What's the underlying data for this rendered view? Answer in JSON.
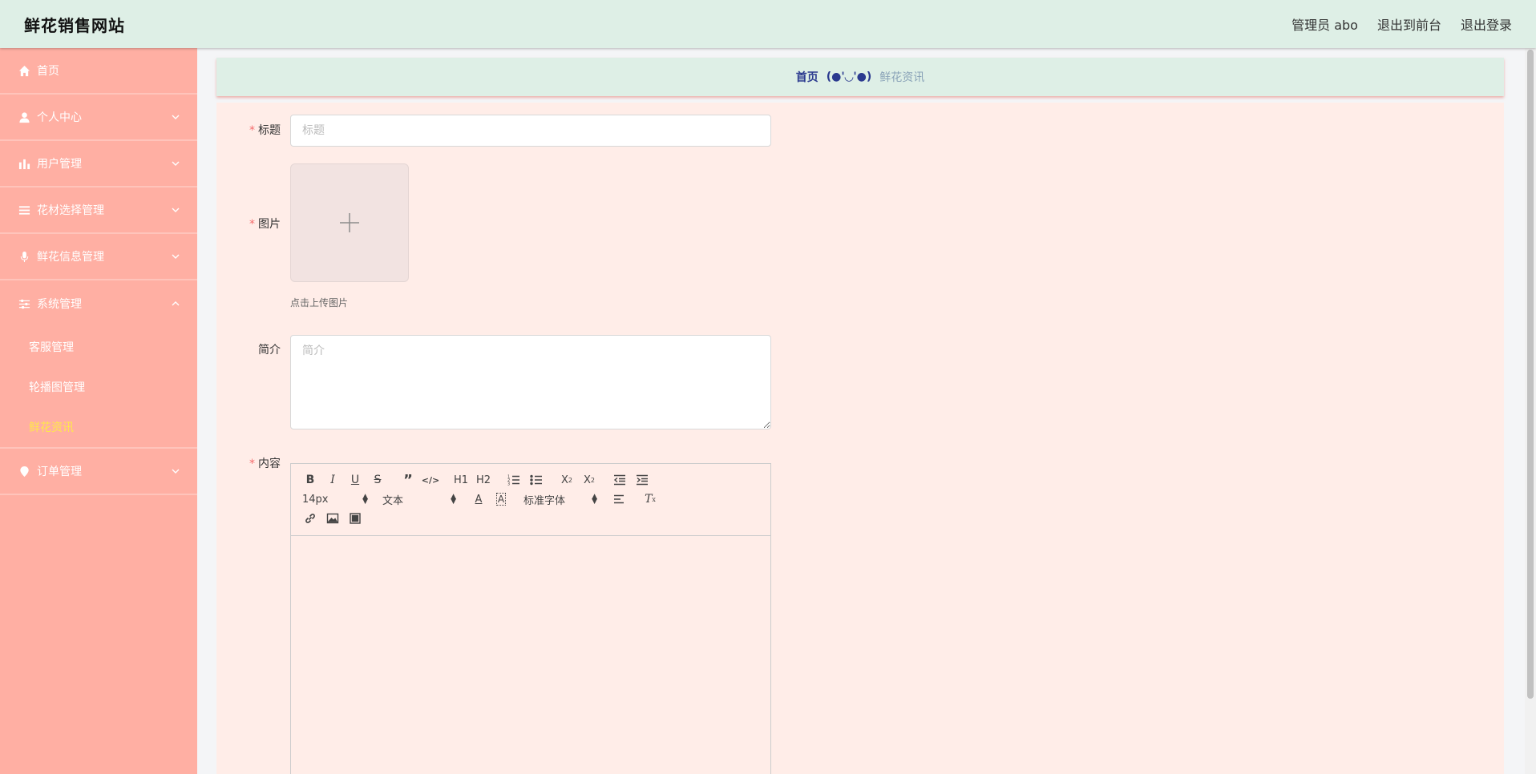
{
  "header": {
    "site_title": "鲜花销售网站",
    "user_label": "管理员 abo",
    "to_front": "退出到前台",
    "logout": "退出登录"
  },
  "sidebar": {
    "items": [
      {
        "label": "首页",
        "icon": "home-icon"
      },
      {
        "label": "个人中心",
        "icon": "user-icon"
      },
      {
        "label": "用户管理",
        "icon": "bar-chart-icon"
      },
      {
        "label": "花材选择管理",
        "icon": "list-icon"
      },
      {
        "label": "鲜花信息管理",
        "icon": "microphone-icon"
      },
      {
        "label": "系统管理",
        "icon": "sliders-icon"
      },
      {
        "label": "订单管理",
        "icon": "map-pin-icon"
      }
    ],
    "sub_items": [
      "客服管理",
      "轮播图管理",
      "鲜花资讯"
    ],
    "active_sub": "鲜花资讯"
  },
  "breadcrumb": {
    "home": "首页",
    "separator": "(●'◡'●)",
    "current": "鲜花资讯"
  },
  "form": {
    "title_label": "标题",
    "title_placeholder": "标题",
    "image_label": "图片",
    "upload_tip": "点击上传图片",
    "summary_label": "简介",
    "summary_placeholder": "简介",
    "content_label": "内容",
    "required_mark": "*"
  },
  "editor": {
    "font_size": "14px",
    "header_select": "文本",
    "font_family": "标准字体",
    "h1": "H1",
    "h2": "H2"
  },
  "colors": {
    "sidebar_bg": "#ffafa3",
    "header_bg": "#deefe6",
    "form_bg": "#ffede8",
    "active_sub": "#ffe84a",
    "required": "#f56c6c"
  }
}
